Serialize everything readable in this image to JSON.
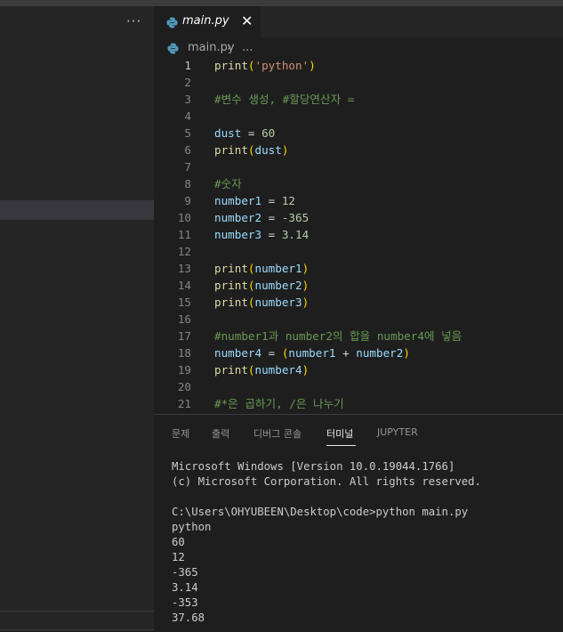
{
  "sidebar": {
    "more_label": "···"
  },
  "tab": {
    "filename": "main.py",
    "close_glyph": "✕"
  },
  "breadcrumb": {
    "file": "main.py",
    "separator": "›",
    "more": "..."
  },
  "editor": {
    "lines": [
      {
        "n": "1",
        "tokens": [
          [
            "fn",
            "print"
          ],
          [
            "p1",
            "("
          ],
          [
            "str",
            "'python'"
          ],
          [
            "p1",
            ")"
          ]
        ]
      },
      {
        "n": "2",
        "tokens": []
      },
      {
        "n": "3",
        "tokens": [
          [
            "cmt",
            "#변수 생성, #할당연산자 ="
          ]
        ]
      },
      {
        "n": "4",
        "tokens": []
      },
      {
        "n": "5",
        "tokens": [
          [
            "var",
            "dust"
          ],
          [
            "op",
            " = "
          ],
          [
            "num",
            "60"
          ]
        ]
      },
      {
        "n": "6",
        "tokens": [
          [
            "fn",
            "print"
          ],
          [
            "p1",
            "("
          ],
          [
            "var",
            "dust"
          ],
          [
            "p1",
            ")"
          ]
        ]
      },
      {
        "n": "7",
        "tokens": []
      },
      {
        "n": "8",
        "tokens": [
          [
            "cmt",
            "#숫자"
          ]
        ]
      },
      {
        "n": "9",
        "tokens": [
          [
            "var",
            "number1"
          ],
          [
            "op",
            " = "
          ],
          [
            "num",
            "12"
          ]
        ]
      },
      {
        "n": "10",
        "tokens": [
          [
            "var",
            "number2"
          ],
          [
            "op",
            " = "
          ],
          [
            "num",
            "-365"
          ]
        ]
      },
      {
        "n": "11",
        "tokens": [
          [
            "var",
            "number3"
          ],
          [
            "op",
            " = "
          ],
          [
            "num",
            "3.14"
          ]
        ]
      },
      {
        "n": "12",
        "tokens": []
      },
      {
        "n": "13",
        "tokens": [
          [
            "fn",
            "print"
          ],
          [
            "p1",
            "("
          ],
          [
            "var",
            "number1"
          ],
          [
            "p1",
            ")"
          ]
        ]
      },
      {
        "n": "14",
        "tokens": [
          [
            "fn",
            "print"
          ],
          [
            "p1",
            "("
          ],
          [
            "var",
            "number2"
          ],
          [
            "p1",
            ")"
          ]
        ]
      },
      {
        "n": "15",
        "tokens": [
          [
            "fn",
            "print"
          ],
          [
            "p1",
            "("
          ],
          [
            "var",
            "number3"
          ],
          [
            "p1",
            ")"
          ]
        ]
      },
      {
        "n": "16",
        "tokens": []
      },
      {
        "n": "17",
        "tokens": [
          [
            "cmt",
            "#number1과 number2의 합을 number4에 넣음"
          ]
        ]
      },
      {
        "n": "18",
        "tokens": [
          [
            "var",
            "number4"
          ],
          [
            "op",
            " = "
          ],
          [
            "p1",
            "("
          ],
          [
            "var",
            "number1"
          ],
          [
            "op",
            " + "
          ],
          [
            "var",
            "number2"
          ],
          [
            "p1",
            ")"
          ]
        ]
      },
      {
        "n": "19",
        "tokens": [
          [
            "fn",
            "print"
          ],
          [
            "p1",
            "("
          ],
          [
            "var",
            "number4"
          ],
          [
            "p1",
            ")"
          ]
        ]
      },
      {
        "n": "20",
        "tokens": []
      },
      {
        "n": "21",
        "tokens": [
          [
            "cmt",
            "#*은 곱하기, /은 나누기"
          ]
        ]
      }
    ]
  },
  "panel": {
    "tabs": [
      "문제",
      "출력",
      "디버그 콘솔",
      "터미널",
      "JUPYTER"
    ],
    "active_tab": "터미널",
    "terminal_lines": [
      "Microsoft Windows [Version 10.0.19044.1766]",
      "(c) Microsoft Corporation. All rights reserved.",
      "",
      "C:\\Users\\OHYUBEEN\\Desktop\\code>python main.py",
      "python",
      "60",
      "12",
      "-365",
      "3.14",
      "-353",
      "37.68"
    ]
  }
}
